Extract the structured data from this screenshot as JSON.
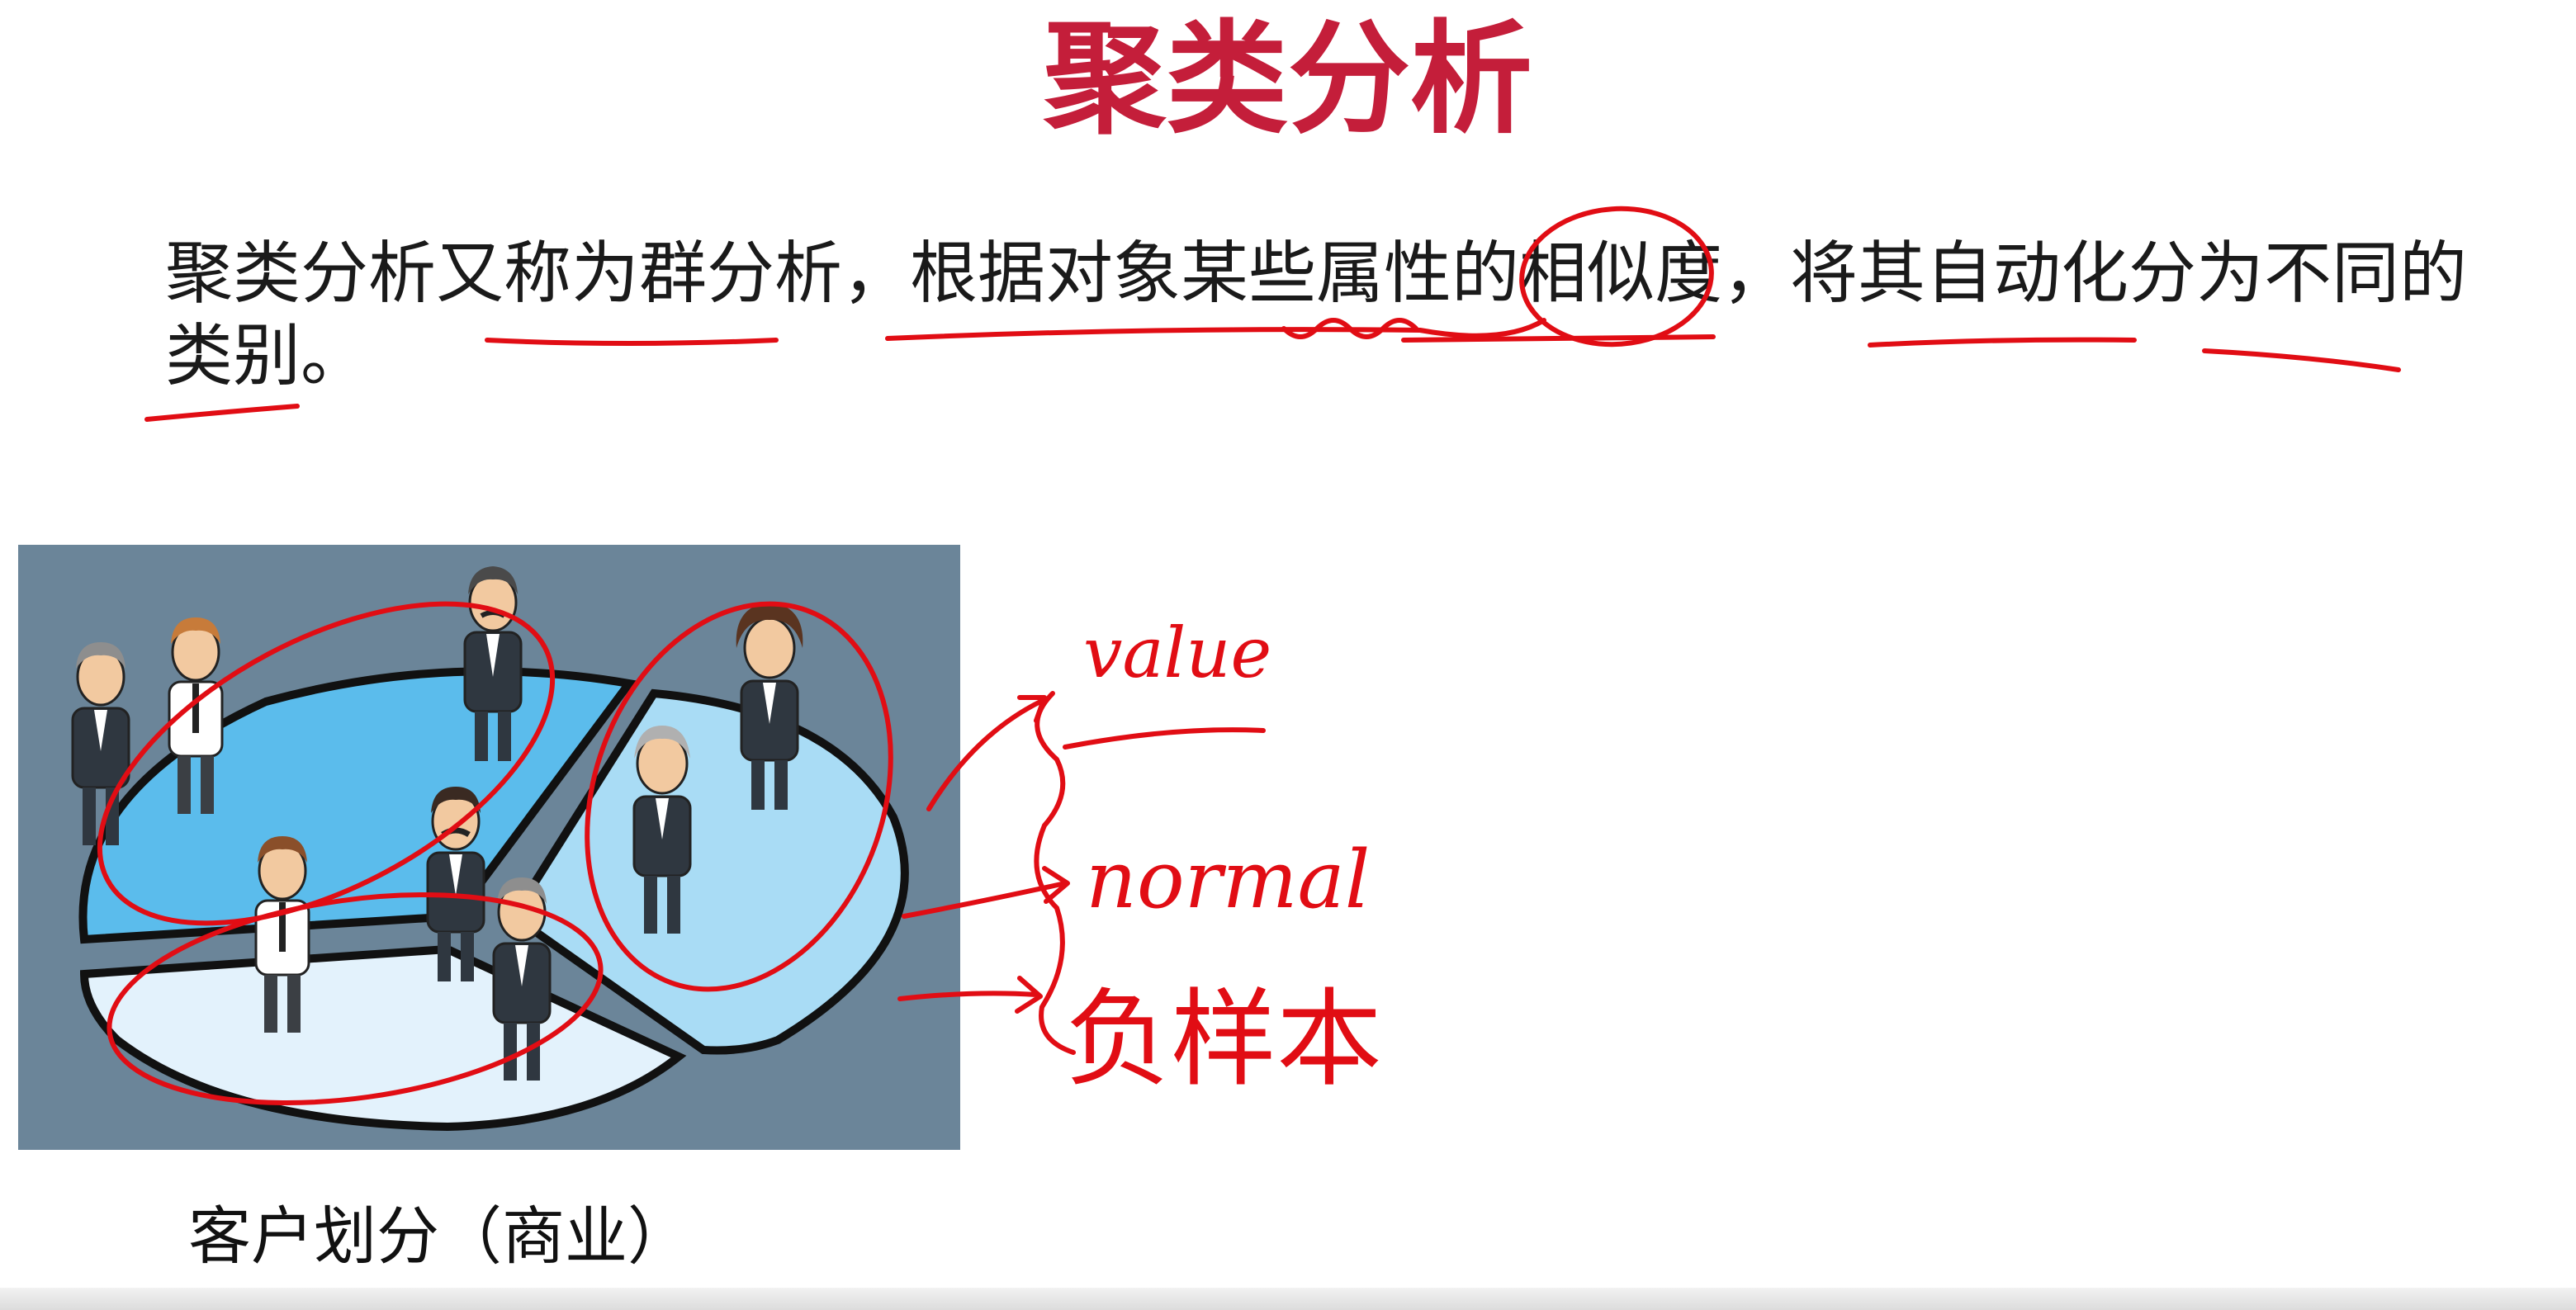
{
  "slide": {
    "title": "聚类分析",
    "definition_line1": "聚类分析又称为群分析，根据对象某些属性的相似度，将其自动化分为不同的",
    "definition_line2": "类别。",
    "caption": "客户划分（商业）"
  },
  "annotations": {
    "value": "value",
    "normal": "normal",
    "negative_sample": "负样本"
  },
  "colors": {
    "title": "#c41e3a",
    "ink": "#e10d14",
    "illustration_bg": "#6b8599",
    "slice_top_left": "#5bbcec",
    "slice_right": "#a9dcf5",
    "slice_bottom": "#e3f2fc"
  },
  "icons": {
    "illustration": "customer-segmentation-pie-with-businessmen"
  }
}
